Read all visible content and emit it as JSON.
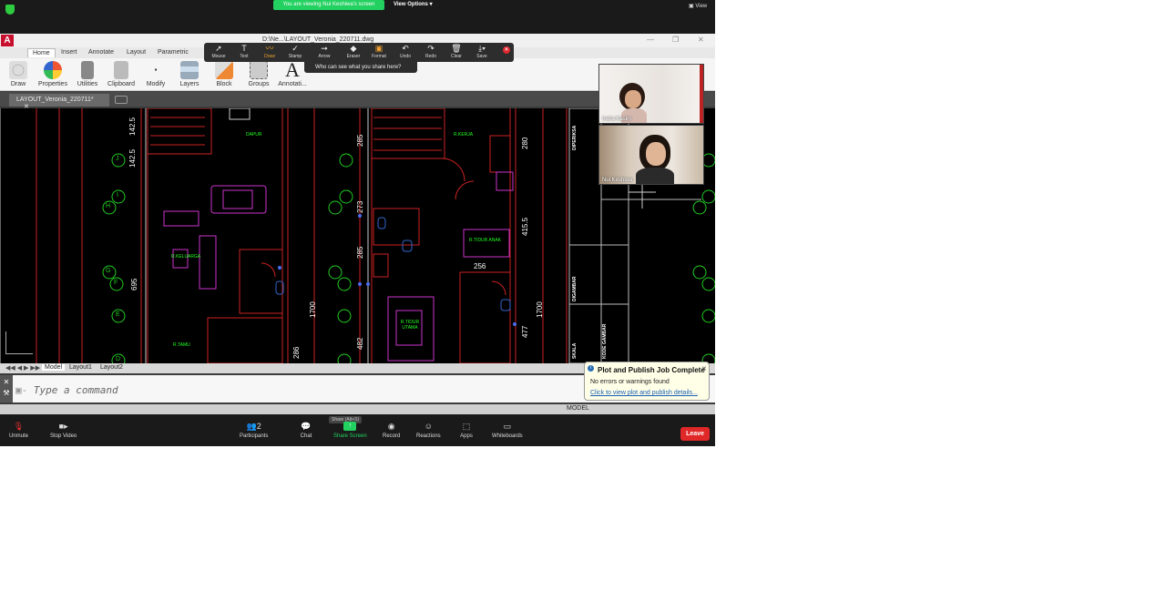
{
  "zoom": {
    "banner": "You are viewing Nui Keshiwa's screen",
    "view_options": "View Options",
    "view": "View",
    "toolbar": {
      "unmute": "Unmute",
      "stop_video": "Stop Video",
      "participants": "Participants",
      "participants_count": "2",
      "chat": "Chat",
      "share_screen": "Share Screen",
      "share_tip": "Share (Alt+S)",
      "record": "Record",
      "reactions": "Reactions",
      "apps": "Apps",
      "whiteboards": "Whiteboards",
      "leave": "Leave"
    },
    "annotate": {
      "tools": [
        "Mouse",
        "Text",
        "Draw",
        "Stamp",
        "Arrow",
        "Eraser",
        "Format",
        "Undo",
        "Redo",
        "Clear",
        "Save"
      ],
      "who_can_see": "Who can see what you share here?"
    },
    "participants": [
      {
        "name": "Indra Kasim"
      },
      {
        "name": "Nui Keshiwa"
      }
    ]
  },
  "acad": {
    "title": "D:\\Ne...\\LAYOUT_Veronia_220711.dwg",
    "ribbon_tabs": [
      "Home",
      "Insert",
      "Annotate",
      "Layout",
      "Parametric"
    ],
    "panels": [
      "Draw",
      "Properties",
      "Utilities",
      "Clipboard",
      "Modify",
      "Layers",
      "Block",
      "Groups",
      "Annotati..."
    ],
    "doc_tab": "LAYOUT_Veronia_220711*",
    "layout_tabs": [
      "Model",
      "Layout1",
      "Layout2"
    ],
    "command_placeholder": "Type a command",
    "status_model": "MODEL",
    "drawing_labels": {
      "dims_left": [
        "142.5",
        "142.5",
        "695",
        "1700",
        "286",
        "482"
      ],
      "dims_right": [
        "285",
        "273",
        "285",
        "256",
        "280",
        "415.5",
        "1700",
        "477"
      ],
      "grid": [
        "J",
        "I",
        "H",
        "G",
        "F",
        "E",
        "D"
      ],
      "rooms": [
        "DAPUR",
        "R.KELUARGA",
        "R.TAMU",
        "R.KERJA",
        "R.TIDUR ANAK",
        "R.TIDUR UTAMA"
      ],
      "titleblock": [
        "DIPERIKSA",
        "DIGAMBAR",
        "KODE GAMBAR",
        "SKALA"
      ]
    },
    "popup": {
      "title": "Plot and Publish Job Complete",
      "message": "No errors or warnings found",
      "link": "Click to view plot and publish details..."
    }
  }
}
